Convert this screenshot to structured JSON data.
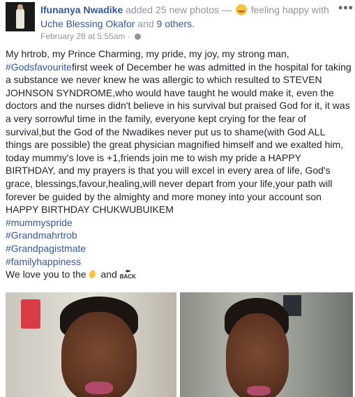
{
  "post": {
    "author": "Ifunanya Nwadike",
    "action_before": "added 25 new photos —",
    "feeling": "feeling happy with",
    "tagged_main": "Uche Blessing Okafor",
    "and_word": "and",
    "tagged_others": "9 others.",
    "timestamp": "February 28 at 5:55am",
    "separator": "·",
    "more_icon": "more-options-icon",
    "text_lines": [
      "My hrtrob, my Prince Charming, my pride, my joy, my strong man,",
      "first week of December he was admitted in the hospital for taking a substance we never knew he was allergic to which resulted to STEVEN JOHNSON SYNDROME,who would have taught he would make it, even the doctors and the nurses didn't believe in his survival but praised God for it, it was a very sorrowful time in the family, everyone kept crying for the fear of survival,but the God of the Nwadikes never put us to shame(with God ALL things are possible) the great physician magnified himself and we exalted him, today mummy's love is +1,friends join me to wish my pride a HAPPY BIRTHDAY, and my prayers is that you will excel in every area of life, God's grace, blessings,favour,healing,will never depart from your life,your path will forever be guided by the almighty and more money into your account son",
      "HAPPY BIRTHDAY CHUKWUBUIKEM"
    ],
    "inline_hashtag": "#Godsfavourite",
    "hashtags": [
      "#mummyspride",
      "#Grandmahrtrob",
      "#Grandpagistmate",
      "#familyhappiness"
    ],
    "closing_before": "We love you to the",
    "closing_and": "and",
    "back_label": "BACK"
  }
}
